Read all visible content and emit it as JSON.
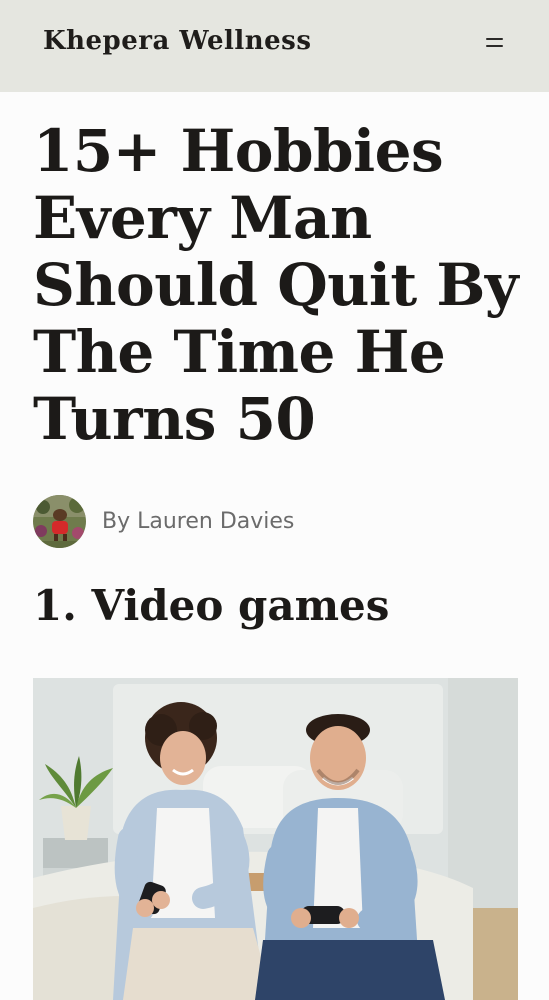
{
  "header": {
    "site_title": "Khepera Wellness",
    "menu_icon": "hamburger-menu-icon",
    "background_color": "#e5e6e0"
  },
  "article": {
    "title": "15+ Hobbies Every Man Should Quit By The Time He Turns 50",
    "byline": "By Lauren Davies",
    "sections": [
      {
        "heading": "1. Video games"
      }
    ]
  },
  "colors": {
    "page_background": "#fcfcfc",
    "text": "#1c1a18",
    "byline_text": "#6b6b6b"
  }
}
